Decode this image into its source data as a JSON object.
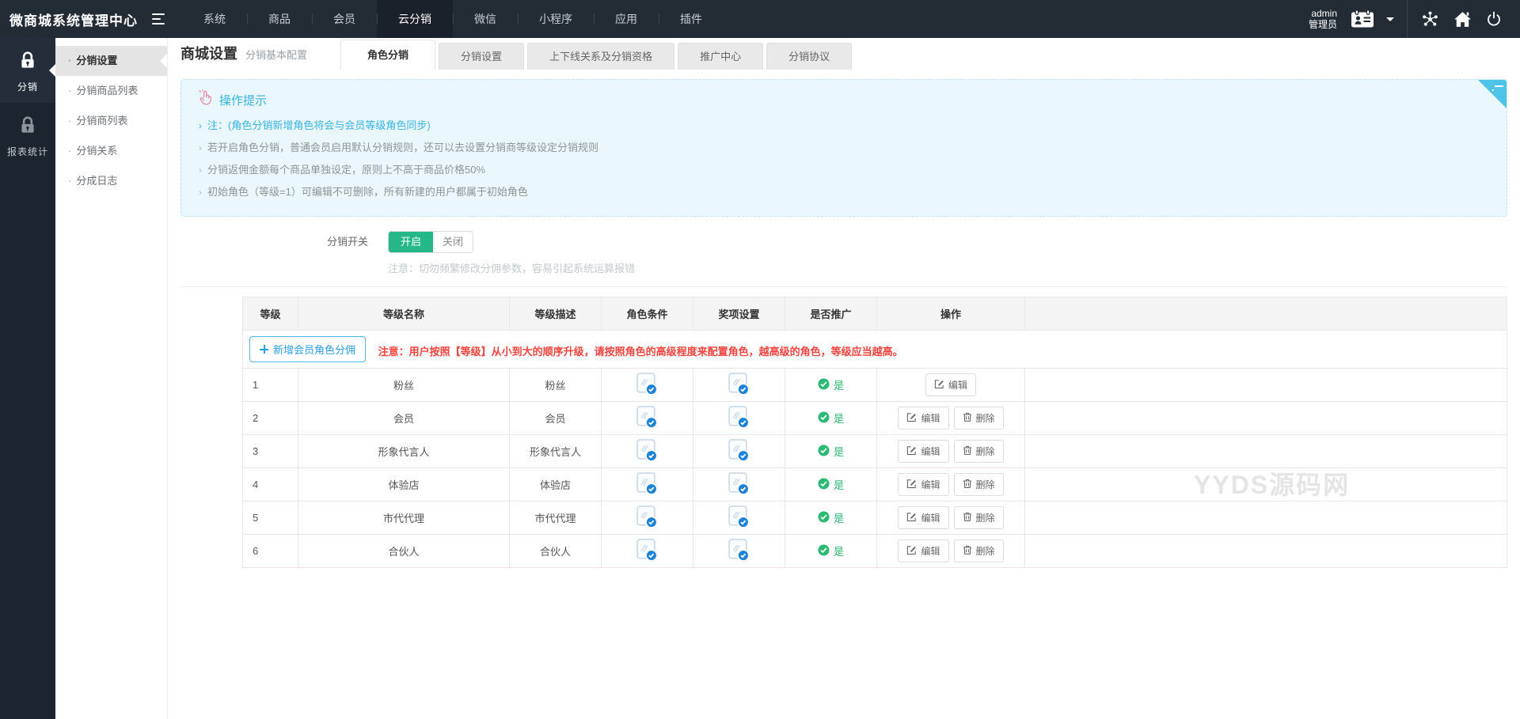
{
  "topbar": {
    "logo": "微商城系统管理中心",
    "menu": [
      {
        "label": "系统",
        "active": false
      },
      {
        "label": "商品",
        "active": false
      },
      {
        "label": "会员",
        "active": false
      },
      {
        "label": "云分销",
        "active": true
      },
      {
        "label": "微信",
        "active": false
      },
      {
        "label": "小程序",
        "active": false
      },
      {
        "label": "应用",
        "active": false
      },
      {
        "label": "插件",
        "active": false
      }
    ],
    "user": {
      "name": "admin",
      "role": "管理员"
    }
  },
  "sidebar": {
    "rail": [
      {
        "label": "分销",
        "icon": "lock-icon",
        "active": true
      },
      {
        "label": "报表统计",
        "icon": "lock-icon",
        "active": false
      }
    ],
    "submenu": [
      {
        "label": "分销设置",
        "active": true
      },
      {
        "label": "分销商品列表",
        "active": false
      },
      {
        "label": "分销商列表",
        "active": false
      },
      {
        "label": "分销关系",
        "active": false
      },
      {
        "label": "分成日志",
        "active": false
      }
    ]
  },
  "header": {
    "title": "商城设置",
    "subtitle": "分销基本配置",
    "tabs": [
      {
        "label": "角色分销",
        "active": true
      },
      {
        "label": "分销设置",
        "active": false
      },
      {
        "label": "上下线关系及分销资格",
        "active": false
      },
      {
        "label": "推广中心",
        "active": false
      },
      {
        "label": "分销协议",
        "active": false
      }
    ]
  },
  "notice": {
    "title": "操作提示",
    "items": [
      {
        "text": "注：(角色分销新增角色将会与会员等级角色同步)",
        "color": "blue"
      },
      {
        "text": "若开启角色分销，普通会员启用默认分销规则，还可以去设置分销商等级设定分销规则",
        "color": "gray"
      },
      {
        "text": "分销返佣金额每个商品单独设定，原则上不高于商品价格50%",
        "color": "gray"
      },
      {
        "text": "初始角色（等级=1）可编辑不可删除，所有新建的用户都属于初始角色",
        "color": "gray"
      }
    ]
  },
  "controls": {
    "switch_label": "分销开关",
    "on_label": "开启",
    "off_label": "关闭",
    "switch_state": "开启",
    "note": "注意：切勿频繁修改分佣参数，容易引起系统运算报错"
  },
  "table": {
    "add_button": "新增会员角色分佣",
    "warning": "注意：用户按照【等级】从小到大的顺序升级，请按照角色的高级程度来配置角色，越高级的角色，等级应当越高。",
    "columns": [
      "等级",
      "等级名称",
      "等级描述",
      "角色条件",
      "奖项设置",
      "是否推广",
      "操作"
    ],
    "yes_label": "是",
    "edit_label": "编辑",
    "delete_label": "删除",
    "rows": [
      {
        "level": "1",
        "name": "粉丝",
        "desc": "粉丝",
        "condition_set": true,
        "reward_set": true,
        "promote": "是",
        "can_delete": false
      },
      {
        "level": "2",
        "name": "会员",
        "desc": "会员",
        "condition_set": true,
        "reward_set": true,
        "promote": "是",
        "can_delete": true
      },
      {
        "level": "3",
        "name": "形象代言人",
        "desc": "形象代言人",
        "condition_set": true,
        "reward_set": true,
        "promote": "是",
        "can_delete": true
      },
      {
        "level": "4",
        "name": "体验店",
        "desc": "体验店",
        "condition_set": true,
        "reward_set": true,
        "promote": "是",
        "can_delete": true
      },
      {
        "level": "5",
        "name": "市代代理",
        "desc": "市代代理",
        "condition_set": true,
        "reward_set": true,
        "promote": "是",
        "can_delete": true
      },
      {
        "level": "6",
        "name": "合伙人",
        "desc": "合伙人",
        "condition_set": true,
        "reward_set": true,
        "promote": "是",
        "can_delete": true
      }
    ]
  },
  "watermark": {
    "text": "YYDS源码网"
  },
  "colors": {
    "topbar_bg": "#232b34",
    "rail_bg": "#1c242f",
    "accent_blue": "#36b4e5",
    "link_blue": "#2b9fe3",
    "badge_blue": "#1b82da",
    "switch_green": "#26b788",
    "success_green": "#2cb973",
    "warning_red": "#f5433d",
    "notice_bg": "#eaf7fd",
    "notice_fold": "#4fc3e8",
    "active_submenu_bg": "#e4e4e4"
  }
}
